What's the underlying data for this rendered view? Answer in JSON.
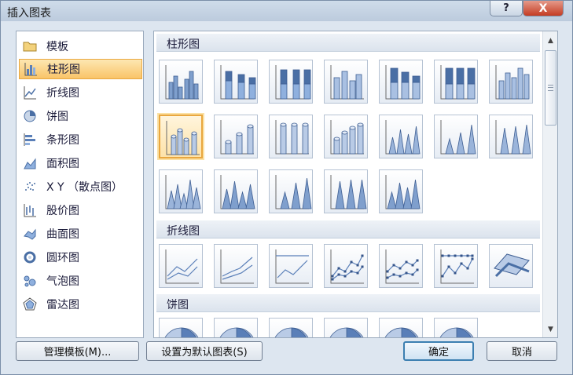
{
  "dialog": {
    "title": "插入图表",
    "help_label": "?",
    "close_label": "X"
  },
  "categories": [
    {
      "label": "模板",
      "icon": "folder-icon",
      "selected": false
    },
    {
      "label": "柱形图",
      "icon": "column-chart-icon",
      "selected": true
    },
    {
      "label": "折线图",
      "icon": "line-chart-icon",
      "selected": false
    },
    {
      "label": "饼图",
      "icon": "pie-chart-icon",
      "selected": false
    },
    {
      "label": "条形图",
      "icon": "bar-chart-icon",
      "selected": false
    },
    {
      "label": "面积图",
      "icon": "area-chart-icon",
      "selected": false
    },
    {
      "label": "X Y （散点图）",
      "icon": "scatter-chart-icon",
      "selected": false
    },
    {
      "label": "股价图",
      "icon": "stock-chart-icon",
      "selected": false
    },
    {
      "label": "曲面图",
      "icon": "surface-chart-icon",
      "selected": false
    },
    {
      "label": "圆环图",
      "icon": "doughnut-chart-icon",
      "selected": false
    },
    {
      "label": "气泡图",
      "icon": "bubble-chart-icon",
      "selected": false
    },
    {
      "label": "雷达图",
      "icon": "radar-chart-icon",
      "selected": false
    }
  ],
  "sections": [
    {
      "title": "柱形图"
    },
    {
      "title": "折线图"
    },
    {
      "title": "饼图"
    }
  ],
  "buttons": {
    "manage_templates": "管理模板(M)...",
    "set_default": "设置为默认图表(S)",
    "ok": "确定",
    "cancel": "取消"
  },
  "colors": {
    "accent": "#4a6fa5",
    "selection": "#f9c468",
    "selection_border": "#e9a73f"
  }
}
